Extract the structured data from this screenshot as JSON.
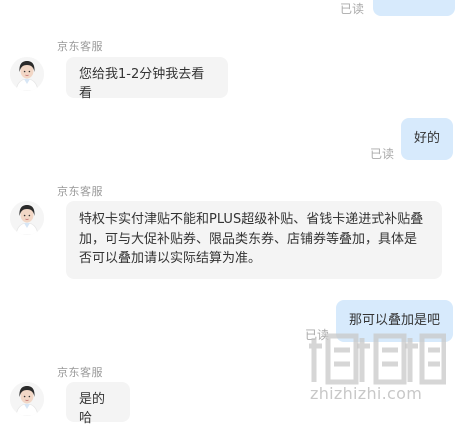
{
  "colors": {
    "agent_bubble": "#f4f4f4",
    "user_bubble": "#d7eafc",
    "read_text": "#aaaaaa",
    "name_text": "#9a9a9a"
  },
  "messages": [
    {
      "from": "user",
      "text": "",
      "status": "已读"
    },
    {
      "from": "agent",
      "name": "京东客服",
      "avatar": "agent-avatar",
      "text": "您给我1-2分钟我去看看"
    },
    {
      "from": "user",
      "text": "好的",
      "status": "已读"
    },
    {
      "from": "agent",
      "name": "京东客服",
      "avatar": "agent-avatar",
      "text": "特权卡实付津贴不能和PLUS超级补贴、省钱卡递进式补贴叠加，可与大促补贴券、限品类东券、店铺券等叠加，具体是否可以叠加请以实际结算为准。"
    },
    {
      "from": "user",
      "text": "那可以叠加是吧",
      "status": "已读"
    },
    {
      "from": "agent",
      "name": "京东客服",
      "avatar": "agent-avatar",
      "text": "是的哈"
    }
  ],
  "watermark": {
    "text": "zhizhizhi.com",
    "logo": "zhi-logo"
  }
}
